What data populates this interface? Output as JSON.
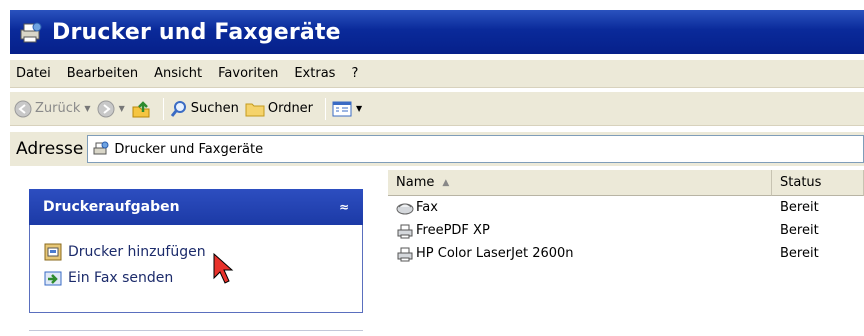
{
  "window": {
    "title": "Drucker und Faxgeräte"
  },
  "menu": {
    "items": [
      "Datei",
      "Bearbeiten",
      "Ansicht",
      "Favoriten",
      "Extras",
      "?"
    ]
  },
  "toolbar": {
    "back": "Zurück",
    "search": "Suchen",
    "folders": "Ordner"
  },
  "address": {
    "label": "Adresse",
    "value": "Drucker und Faxgeräte"
  },
  "tasks": {
    "header": "Druckeraufgaben",
    "collapse_glyph": "≈",
    "items": [
      "Drucker hinzufügen",
      "Ein Fax senden"
    ]
  },
  "list": {
    "columns": [
      "Name",
      "Status"
    ],
    "rows": [
      {
        "name": "Fax",
        "status": "Bereit",
        "icon": "fax-icon"
      },
      {
        "name": "FreePDF XP",
        "status": "Bereit",
        "icon": "printer-icon"
      },
      {
        "name": "HP Color LaserJet 2600n",
        "status": "Bereit",
        "icon": "printer-icon"
      }
    ]
  },
  "colors": {
    "title_bar": "#0a2a9a",
    "task_header": "#2d4ec0",
    "chrome": "#ece9d8"
  }
}
